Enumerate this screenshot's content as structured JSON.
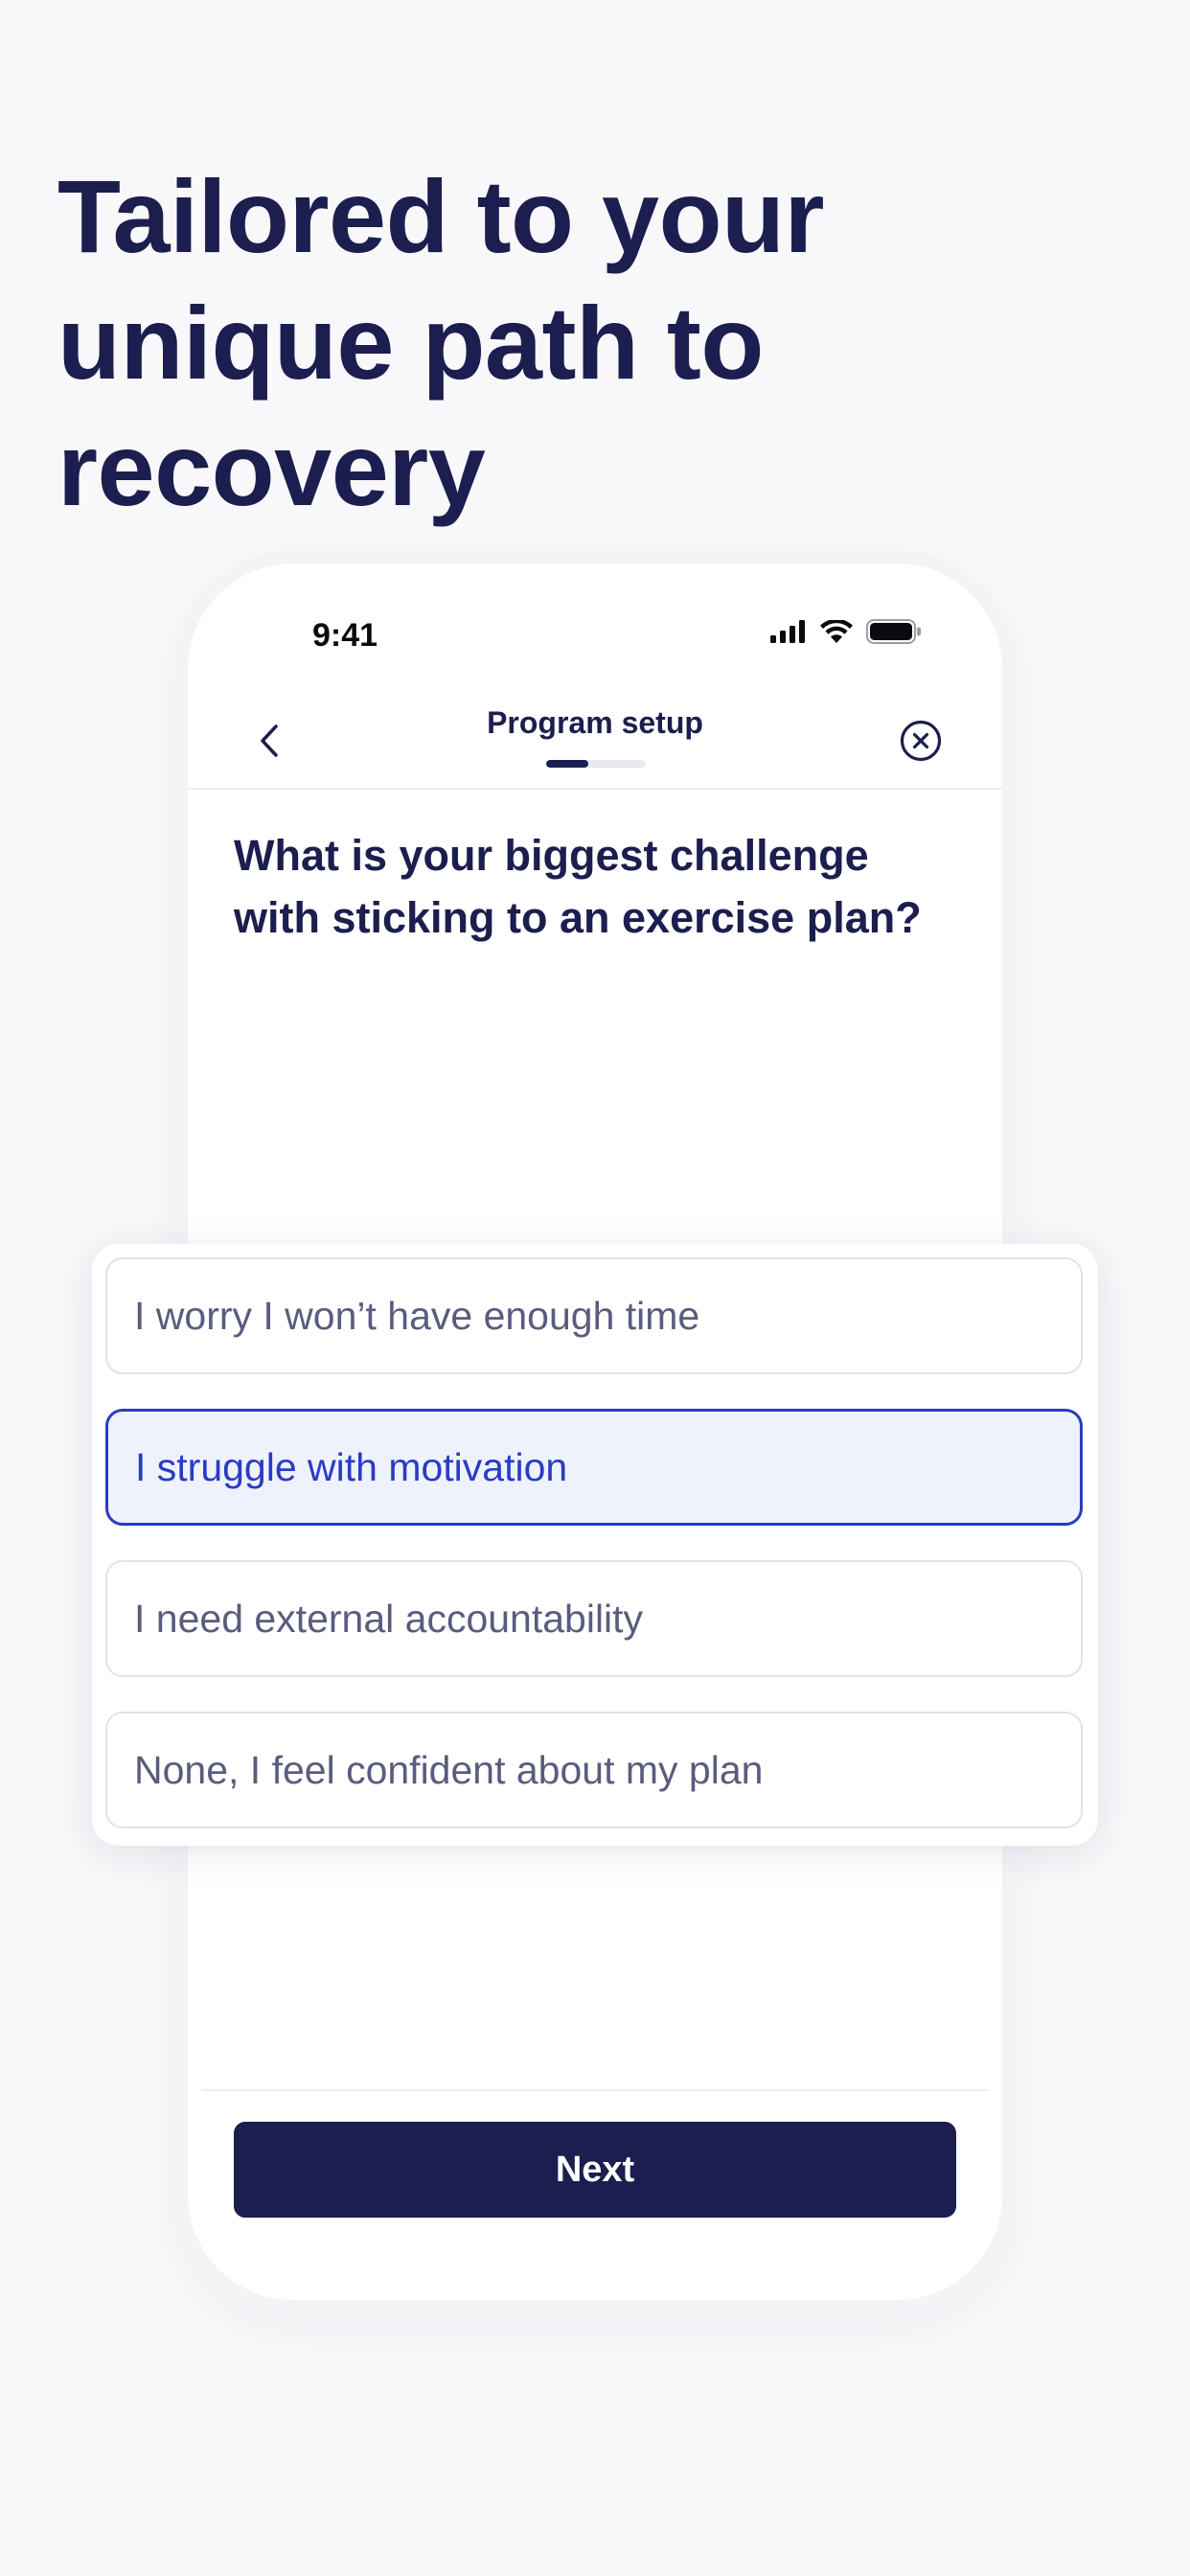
{
  "headline": "Tailored to your unique path to recovery",
  "status_bar": {
    "time": "9:41"
  },
  "nav": {
    "title": "Program setup",
    "progress": 0.42
  },
  "question": "What is your biggest challenge with sticking to an exercise plan?",
  "options": [
    {
      "label": "I worry I won’t have enough time",
      "selected": false
    },
    {
      "label": "I struggle with motivation",
      "selected": true
    },
    {
      "label": "I need external accountability",
      "selected": false
    },
    {
      "label": "None, I feel confident about my plan",
      "selected": false
    }
  ],
  "next_button": "Next",
  "colors": {
    "navy": "#1c1e4f",
    "selected_blue": "#2a3bc4",
    "selected_bg": "#edf2fd",
    "page_bg": "#f8f8fa"
  },
  "icons": [
    "signal-icon",
    "wifi-icon",
    "battery-icon",
    "back-chevron-icon",
    "close-circle-icon"
  ]
}
